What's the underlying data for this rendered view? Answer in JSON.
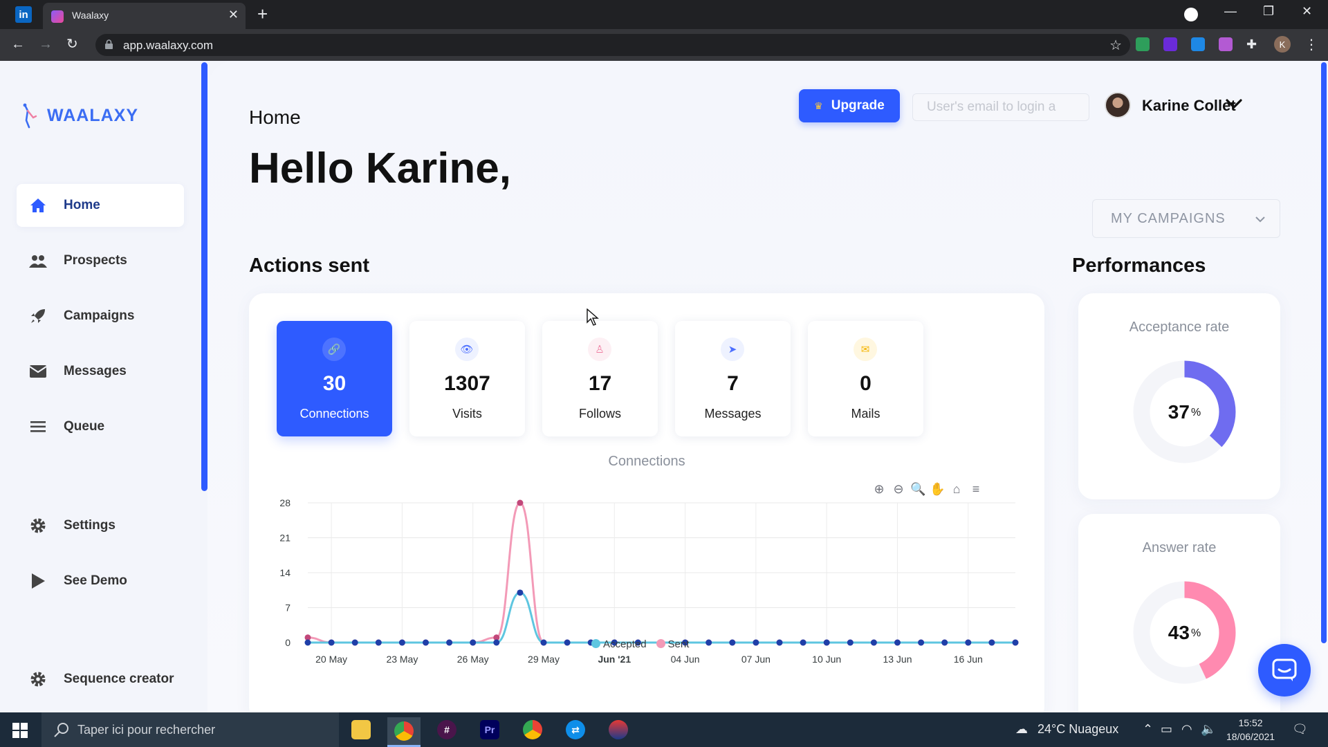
{
  "browser": {
    "pinned_tab": "in",
    "tab_title": "Waalaxy",
    "tab_close": "✕",
    "new_tab": "+",
    "url": "app.waalaxy.com",
    "avatar_initial": "K"
  },
  "sidebar": {
    "logo_text": "WAALAXY",
    "items": [
      {
        "label": "Home",
        "icon": "home-icon"
      },
      {
        "label": "Prospects",
        "icon": "users-icon"
      },
      {
        "label": "Campaigns",
        "icon": "rocket-icon"
      },
      {
        "label": "Messages",
        "icon": "envelope-icon"
      },
      {
        "label": "Queue",
        "icon": "list-icon"
      },
      {
        "label": "Settings",
        "icon": "gear-icon"
      },
      {
        "label": "See Demo",
        "icon": "play-icon"
      },
      {
        "label": "Sequence creator",
        "icon": "gear-icon"
      }
    ]
  },
  "header": {
    "breadcrumb": "Home",
    "greeting": "Hello Karine,",
    "upgrade_label": "Upgrade",
    "email_placeholder": "User's email to login a",
    "user_name": "Karine Collet",
    "campaign_select": "MY CAMPAIGNS"
  },
  "actions": {
    "title": "Actions sent",
    "stats": [
      {
        "value": "30",
        "label": "Connections",
        "icon": "link-icon",
        "color": "#2e5bff"
      },
      {
        "value": "1307",
        "label": "Visits",
        "icon": "eye-icon",
        "color": "#4c6fff"
      },
      {
        "value": "17",
        "label": "Follows",
        "icon": "user-icon",
        "color": "#ef7fa3"
      },
      {
        "value": "7",
        "label": "Messages",
        "icon": "send-icon",
        "color": "#4c6fff"
      },
      {
        "value": "0",
        "label": "Mails",
        "icon": "envelope-icon",
        "color": "#f5b400"
      }
    ]
  },
  "chart_data": {
    "type": "line",
    "title": "Connections",
    "xlabel": "",
    "ylabel": "",
    "ylim": [
      0,
      28
    ],
    "yticks": [
      "0",
      "7",
      "14",
      "21",
      "28"
    ],
    "x": [
      "19 May",
      "20 May",
      "21 May",
      "22 May",
      "23 May",
      "24 May",
      "25 May",
      "26 May",
      "27 May",
      "28 May",
      "29 May",
      "30 May",
      "31 May",
      "Jun '21",
      "02 Jun",
      "03 Jun",
      "04 Jun",
      "05 Jun",
      "06 Jun",
      "07 Jun",
      "08 Jun",
      "09 Jun",
      "10 Jun",
      "11 Jun",
      "12 Jun",
      "13 Jun",
      "14 Jun",
      "15 Jun",
      "16 Jun",
      "17 Jun",
      "18 Jun"
    ],
    "xtick_labels": [
      "20 May",
      "23 May",
      "26 May",
      "29 May",
      "Jun '21",
      "04 Jun",
      "07 Jun",
      "10 Jun",
      "13 Jun",
      "16 Jun"
    ],
    "series": [
      {
        "name": "Accepted",
        "color": "#5ec6e0",
        "point_color": "#1f3fa8",
        "values": [
          0,
          0,
          0,
          0,
          0,
          0,
          0,
          0,
          0,
          10,
          0,
          0,
          0,
          0,
          0,
          0,
          0,
          0,
          0,
          0,
          0,
          0,
          0,
          0,
          0,
          0,
          0,
          0,
          0,
          0,
          0
        ]
      },
      {
        "name": "Sent",
        "color": "#f39ab7",
        "point_color": "#c2487a",
        "values": [
          1,
          0,
          0,
          0,
          0,
          0,
          0,
          0,
          1,
          28,
          0,
          0,
          0,
          0,
          0,
          0,
          0,
          0,
          0,
          0,
          0,
          0,
          0,
          0,
          0,
          0,
          0,
          0,
          0,
          0,
          0
        ]
      }
    ],
    "grid": true,
    "legend": "bottom-center"
  },
  "performances": {
    "title": "Performances",
    "acceptance": {
      "label": "Acceptance rate",
      "value": "37",
      "unit": "%",
      "fraction": 0.37,
      "color": "#6f6cf0"
    },
    "answer": {
      "label": "Answer rate",
      "value": "43",
      "unit": "%",
      "fraction": 0.43,
      "color": "#ff8ab0"
    }
  },
  "taskbar": {
    "search_placeholder": "Taper ici pour rechercher",
    "weather": "24°C Nuageux",
    "time": "15:52",
    "date": "18/06/2021"
  }
}
